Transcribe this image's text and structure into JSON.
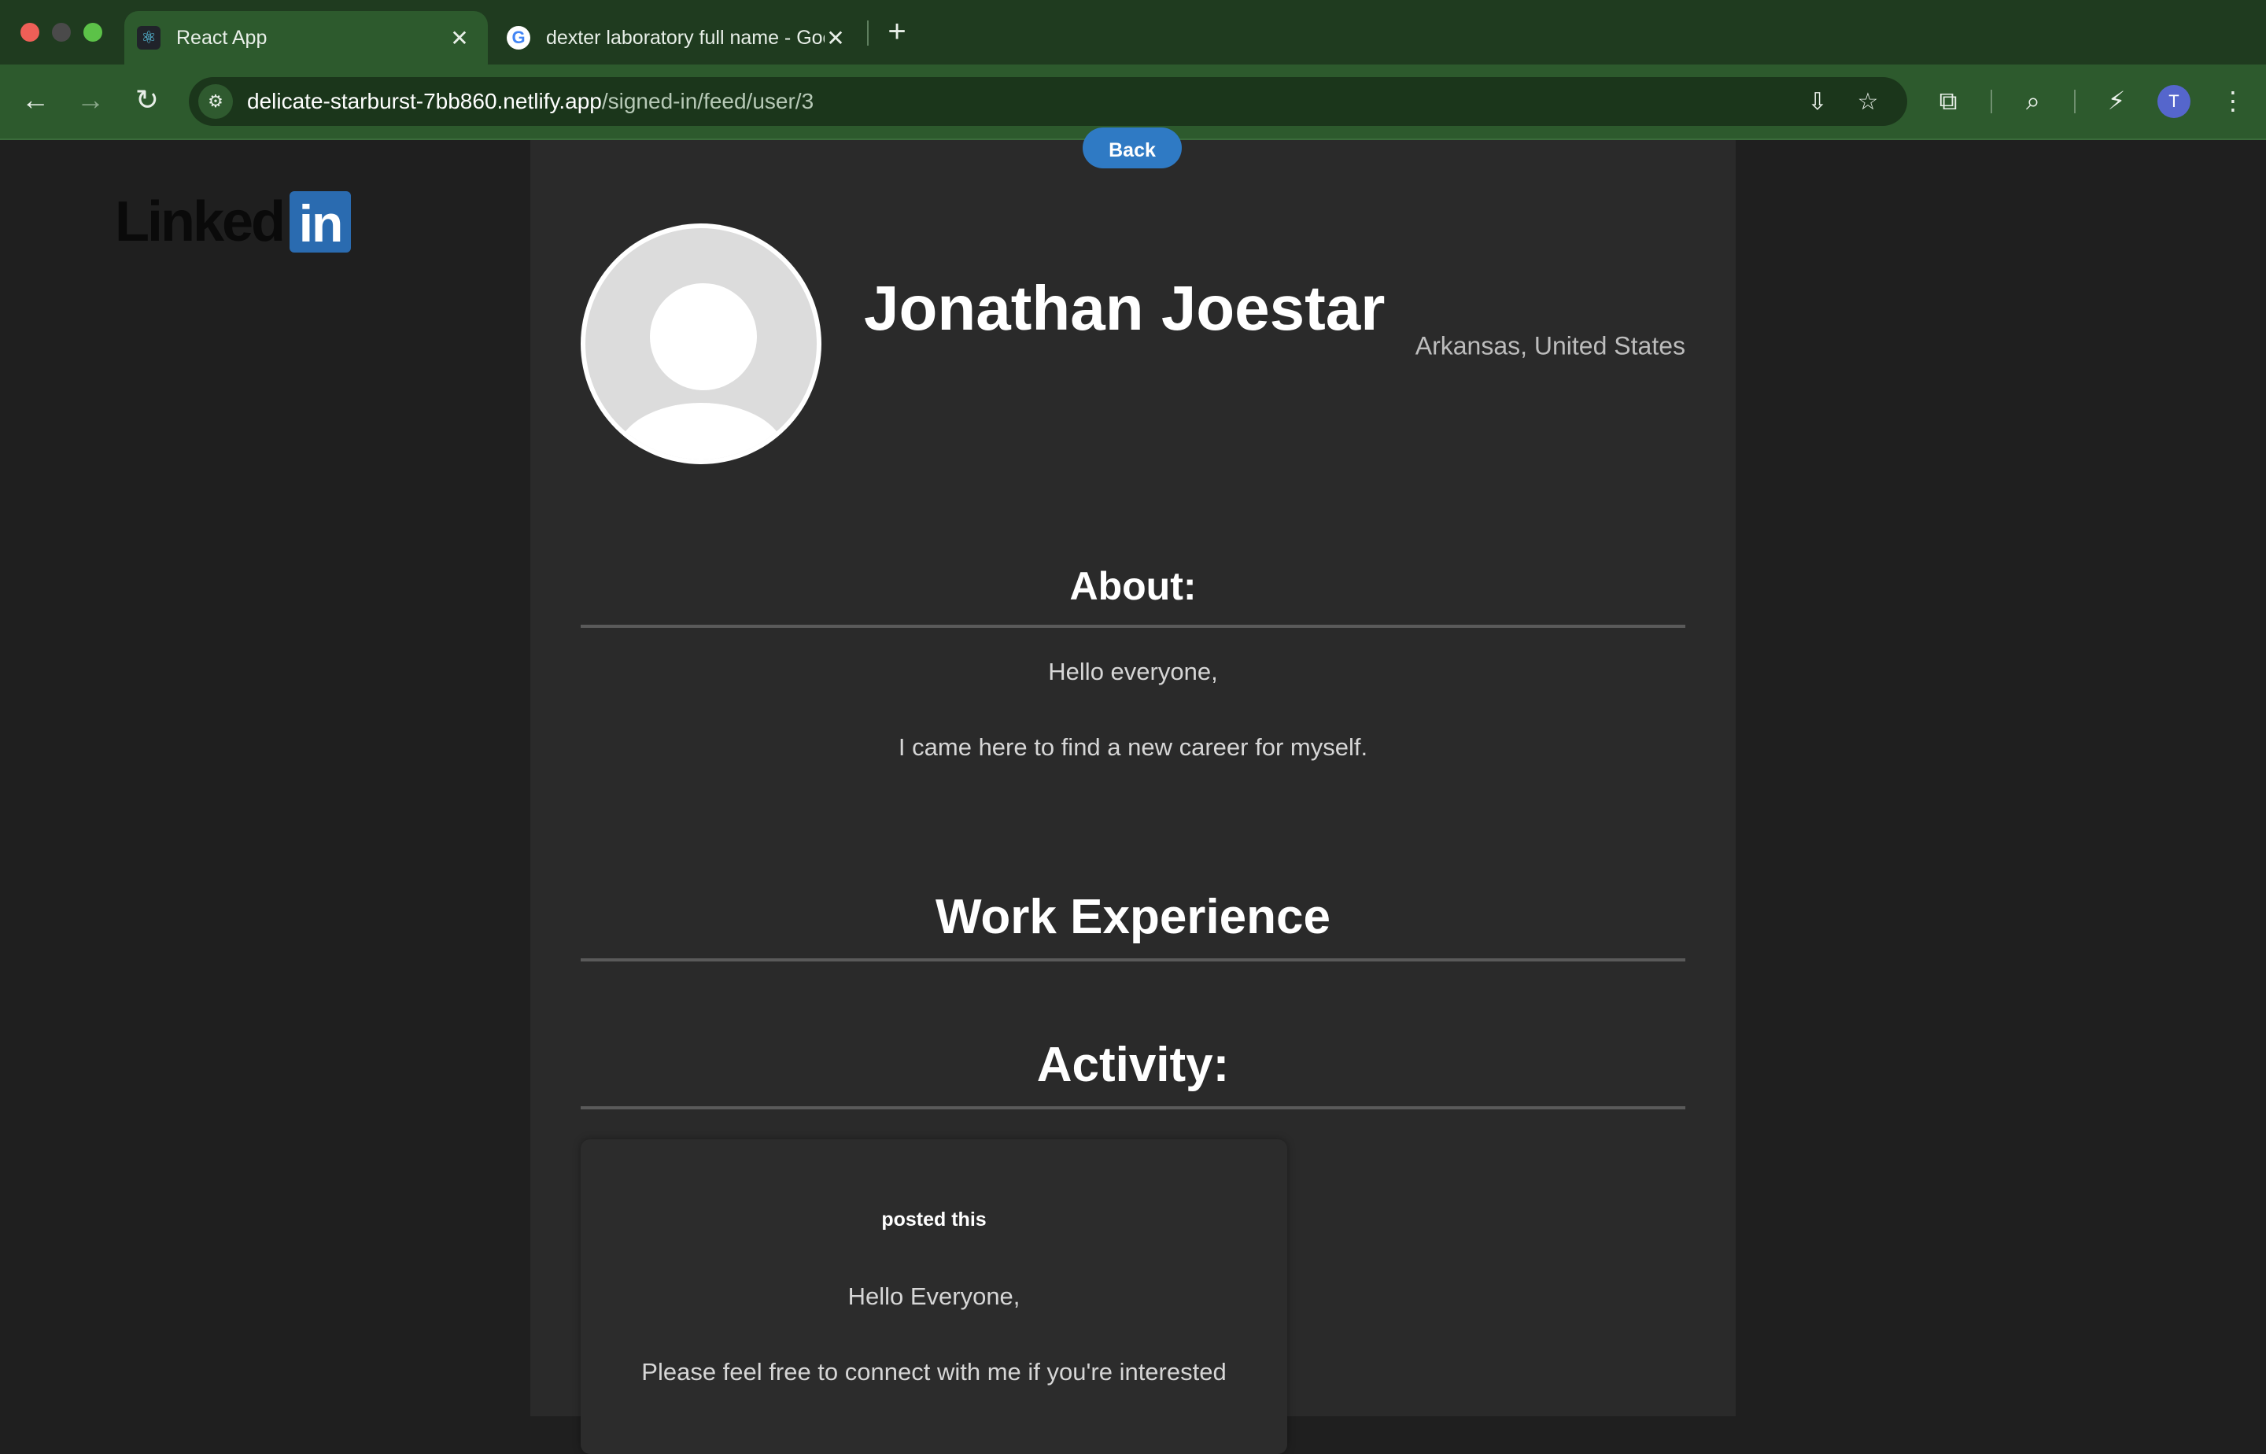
{
  "browser": {
    "tabs": [
      {
        "title": "React App",
        "favicon": "react-icon",
        "active": true
      },
      {
        "title": "dexter laboratory full name - Google Search",
        "favicon": "google-icon",
        "active": false
      }
    ],
    "url_host": "delicate-starburst-7bb860.netlify.app",
    "url_path": "/signed-in/feed/user/3",
    "profile_initial": "T"
  },
  "logo": {
    "text": "Linked",
    "badge": "in"
  },
  "page": {
    "back_label": "Back",
    "profile": {
      "name": "Jonathan Joestar",
      "location": "Arkansas, United States"
    },
    "about": {
      "heading": "About:",
      "lines": [
        "Hello everyone,",
        "I came here to find a new career for myself."
      ]
    },
    "work": {
      "heading": "Work Experience"
    },
    "activity": {
      "heading": "Activity:",
      "posts": [
        {
          "meta": "posted this",
          "lines": [
            "Hello Everyone,",
            "Please feel free to connect with me if you're interested"
          ]
        }
      ]
    }
  },
  "colors": {
    "accent": "#2f7ac4",
    "chrome": "#2d5a2d",
    "panel": "#2a2a2a",
    "linkedin": "#2a6bb0"
  }
}
